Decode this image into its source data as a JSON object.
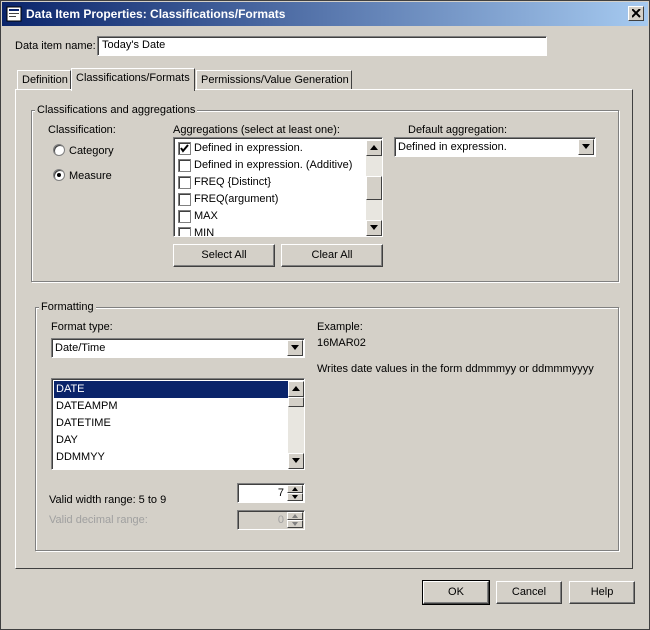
{
  "window": {
    "title": "Data Item Properties: Classifications/Formats"
  },
  "data_item_name": {
    "label": "Data item name:",
    "value": "Today's Date"
  },
  "tabs": [
    {
      "label": "Definition",
      "active": false
    },
    {
      "label": "Classifications/Formats",
      "active": true
    },
    {
      "label": "Permissions/Value Generation",
      "active": false
    }
  ],
  "classifications": {
    "group_title": "Classifications and aggregations",
    "classification_label": "Classification:",
    "options": [
      {
        "label": "Category",
        "selected": false
      },
      {
        "label": "Measure",
        "selected": true
      }
    ],
    "aggregations_label": "Aggregations (select at least one):",
    "aggregations": [
      {
        "label": "Defined in expression.",
        "checked": true
      },
      {
        "label": "Defined in expression. (Additive)",
        "checked": false
      },
      {
        "label": "FREQ {Distinct}",
        "checked": false
      },
      {
        "label": "FREQ(argument)",
        "checked": false
      },
      {
        "label": "MAX",
        "checked": false
      },
      {
        "label": "MIN",
        "checked": false
      }
    ],
    "default_aggregation_label": "Default aggregation:",
    "default_aggregation_value": "Defined in expression.",
    "select_all": "Select All",
    "clear_all": "Clear All"
  },
  "formatting": {
    "group_title": "Formatting",
    "format_type_label": "Format type:",
    "format_type_value": "Date/Time",
    "formats": [
      "DATE",
      "DATEAMPM",
      "DATETIME",
      "DAY",
      "DDMMYY"
    ],
    "selected_format": "DATE",
    "example_label": "Example:",
    "example_value": "16MAR02",
    "description": "Writes date values in the form ddmmmyy or ddmmmyyyy",
    "width_label": "Valid width range: 5 to 9",
    "width_value": "7",
    "decimal_label": "Valid decimal range:",
    "decimal_value": "0"
  },
  "buttons": {
    "ok": "OK",
    "cancel": "Cancel",
    "help": "Help"
  },
  "icons": {
    "title": "data-item-properties-icon",
    "close": "close-icon",
    "scroll_up": "scroll-up-arrow-icon",
    "scroll_down": "scroll-down-arrow-icon",
    "dropdown": "dropdown-arrow-icon",
    "checkmark": "checkmark-icon"
  },
  "colors": {
    "titlebar": "#0a246a",
    "selection": "#0a246a",
    "face": "#d4d0c8"
  }
}
